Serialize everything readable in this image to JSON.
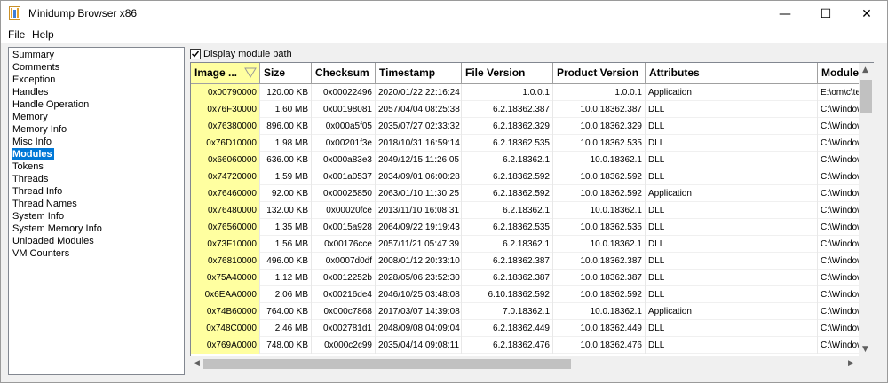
{
  "window": {
    "title": "Minidump Browser x86",
    "minimize_glyph": "—",
    "maximize_glyph": "☐",
    "close_glyph": "✕"
  },
  "menu": [
    "File",
    "Help"
  ],
  "sidebar": {
    "items": [
      {
        "label": "Summary"
      },
      {
        "label": "Comments"
      },
      {
        "label": "Exception"
      },
      {
        "label": "Handles"
      },
      {
        "label": "Handle Operation"
      },
      {
        "label": "Memory"
      },
      {
        "label": "Memory Info"
      },
      {
        "label": "Misc Info"
      },
      {
        "label": "Modules",
        "selected": true
      },
      {
        "label": "Tokens"
      },
      {
        "label": "Threads"
      },
      {
        "label": "Thread Info"
      },
      {
        "label": "Thread Names"
      },
      {
        "label": "System Info"
      },
      {
        "label": "System Memory Info"
      },
      {
        "label": "Unloaded Modules"
      },
      {
        "label": "VM Counters"
      }
    ]
  },
  "options": {
    "display_module_path_label": "Display module path",
    "display_module_path_checked": true
  },
  "table": {
    "sorted_column": 0,
    "columns": [
      "Image ...",
      "Size",
      "Checksum",
      "Timestamp",
      "File Version",
      "Product Version",
      "Attributes",
      "Module"
    ],
    "rows": [
      [
        "0x00790000",
        "120.00 KB",
        "0x00022496",
        "2020/01/22 22:16:24",
        "1.0.0.1",
        "1.0.0.1",
        "Application",
        "E:\\om\\c\\te"
      ],
      [
        "0x76F30000",
        "1.60 MB",
        "0x00198081",
        "2057/04/04 08:25:38",
        "6.2.18362.387",
        "10.0.18362.387",
        "DLL",
        "C:\\Window"
      ],
      [
        "0x76380000",
        "896.00 KB",
        "0x000a5f05",
        "2035/07/27 02:33:32",
        "6.2.18362.329",
        "10.0.18362.329",
        "DLL",
        "C:\\Window"
      ],
      [
        "0x76D10000",
        "1.98 MB",
        "0x00201f3e",
        "2018/10/31 16:59:14",
        "6.2.18362.535",
        "10.0.18362.535",
        "DLL",
        "C:\\Window"
      ],
      [
        "0x66060000",
        "636.00 KB",
        "0x000a83e3",
        "2049/12/15 11:26:05",
        "6.2.18362.1",
        "10.0.18362.1",
        "DLL",
        "C:\\Window"
      ],
      [
        "0x74720000",
        "1.59 MB",
        "0x001a0537",
        "2034/09/01 06:00:28",
        "6.2.18362.592",
        "10.0.18362.592",
        "DLL",
        "C:\\Window"
      ],
      [
        "0x76460000",
        "92.00 KB",
        "0x00025850",
        "2063/01/10 11:30:25",
        "6.2.18362.592",
        "10.0.18362.592",
        "Application",
        "C:\\Window"
      ],
      [
        "0x76480000",
        "132.00 KB",
        "0x00020fce",
        "2013/11/10 16:08:31",
        "6.2.18362.1",
        "10.0.18362.1",
        "DLL",
        "C:\\Window"
      ],
      [
        "0x76560000",
        "1.35 MB",
        "0x0015a928",
        "2064/09/22 19:19:43",
        "6.2.18362.535",
        "10.0.18362.535",
        "DLL",
        "C:\\Window"
      ],
      [
        "0x73F10000",
        "1.56 MB",
        "0x00176cce",
        "2057/11/21 05:47:39",
        "6.2.18362.1",
        "10.0.18362.1",
        "DLL",
        "C:\\Window"
      ],
      [
        "0x76810000",
        "496.00 KB",
        "0x0007d0df",
        "2008/01/12 20:33:10",
        "6.2.18362.387",
        "10.0.18362.387",
        "DLL",
        "C:\\Window"
      ],
      [
        "0x75A40000",
        "1.12 MB",
        "0x0012252b",
        "2028/05/06 23:52:30",
        "6.2.18362.387",
        "10.0.18362.387",
        "DLL",
        "C:\\Window"
      ],
      [
        "0x6EAA0000",
        "2.06 MB",
        "0x00216de4",
        "2046/10/25 03:48:08",
        "6.10.18362.592",
        "10.0.18362.592",
        "DLL",
        "C:\\Window"
      ],
      [
        "0x74B60000",
        "764.00 KB",
        "0x000c7868",
        "2017/03/07 14:39:08",
        "7.0.18362.1",
        "10.0.18362.1",
        "Application",
        "C:\\Window"
      ],
      [
        "0x748C0000",
        "2.46 MB",
        "0x002781d1",
        "2048/09/08 04:09:04",
        "6.2.18362.449",
        "10.0.18362.449",
        "DLL",
        "C:\\Window"
      ],
      [
        "0x769A0000",
        "748.00 KB",
        "0x000c2c99",
        "2035/04/14 09:08:11",
        "6.2.18362.476",
        "10.0.18362.476",
        "DLL",
        "C:\\Window"
      ]
    ]
  }
}
